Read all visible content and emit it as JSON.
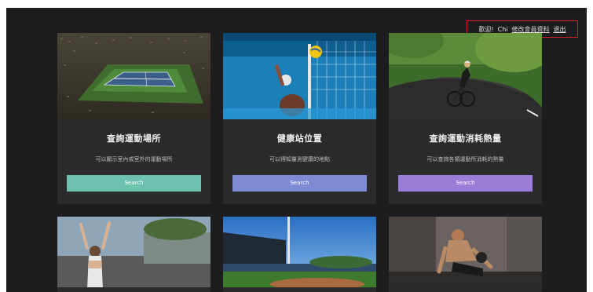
{
  "header": {
    "welcome": "歡迎!",
    "user_name": "Chi",
    "edit_profile": "修改會員資料",
    "logout": "退出"
  },
  "cards": [
    {
      "title": "查詢運動場所",
      "desc": "可以顯示室內或室外的運動場所",
      "button": "Search",
      "button_color": "#6cc2ac"
    },
    {
      "title": "健康站位置",
      "desc": "可以得知量測健康的地點",
      "button": "Search",
      "button_color": "#7e8bd4"
    },
    {
      "title": "查詢運動消耗熱量",
      "desc": "可以查詢各類運動所消耗的熱量",
      "button": "Search",
      "button_color": "#9b7cd6"
    }
  ],
  "colors": {
    "background": "#1d1d1f",
    "card": "#2b2b2d",
    "highlight_border": "#d81f26"
  }
}
